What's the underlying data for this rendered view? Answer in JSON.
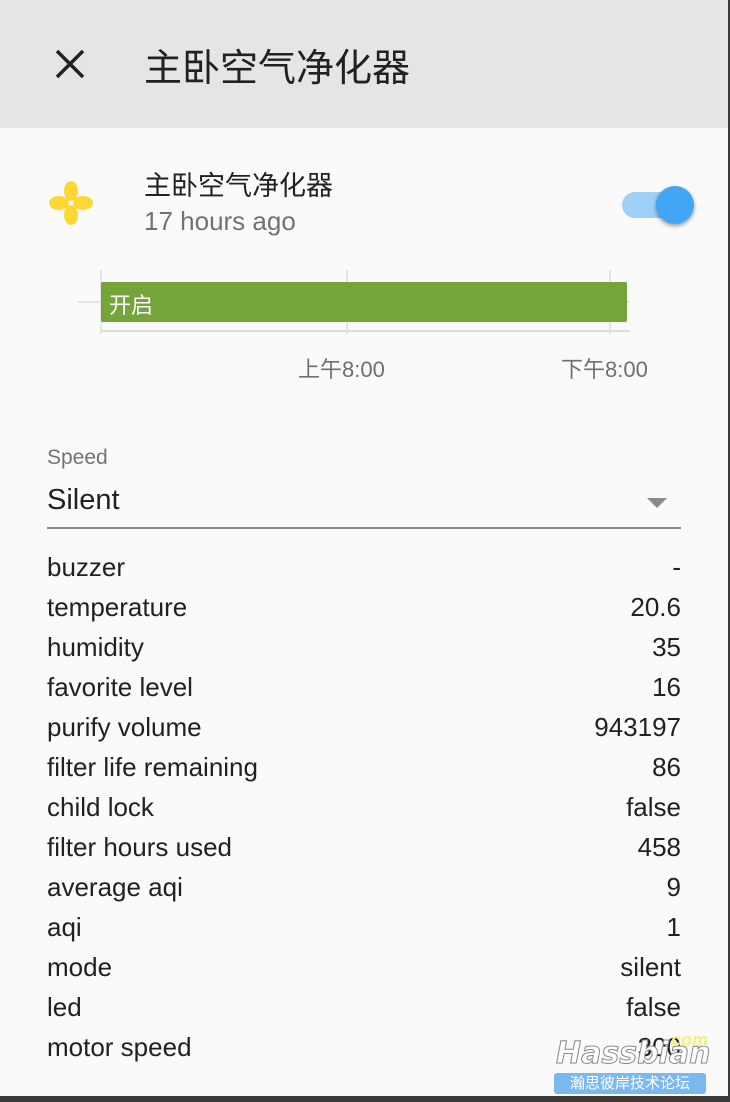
{
  "header": {
    "title": "主卧空气净化器",
    "close_icon": "close-icon"
  },
  "entity": {
    "name": "主卧空气净化器",
    "last_changed": "17 hours ago",
    "icon": "fan-icon",
    "icon_color": "#fdd835",
    "state_on": true,
    "toggle_color": "#42a5f5"
  },
  "timeline": {
    "bar_label": "开启",
    "bar_color": "#74a43a",
    "ticks": [
      "上午8:00",
      "下午8:00"
    ]
  },
  "speed": {
    "label": "Speed",
    "value": "Silent"
  },
  "attributes": [
    {
      "key": "buzzer",
      "value": "-"
    },
    {
      "key": "temperature",
      "value": "20.6"
    },
    {
      "key": "humidity",
      "value": "35"
    },
    {
      "key": "favorite level",
      "value": "16"
    },
    {
      "key": "purify volume",
      "value": "943197"
    },
    {
      "key": "filter life remaining",
      "value": "86"
    },
    {
      "key": "child lock",
      "value": "false"
    },
    {
      "key": "filter hours used",
      "value": "458"
    },
    {
      "key": "average aqi",
      "value": "9"
    },
    {
      "key": "aqi",
      "value": "1"
    },
    {
      "key": "mode",
      "value": "silent"
    },
    {
      "key": "led",
      "value": "false"
    },
    {
      "key": "motor speed",
      "value": "300"
    }
  ],
  "watermark": {
    "logo": "Hassbian",
    "suffix": "com",
    "tagline": "瀚思彼岸技术论坛"
  }
}
